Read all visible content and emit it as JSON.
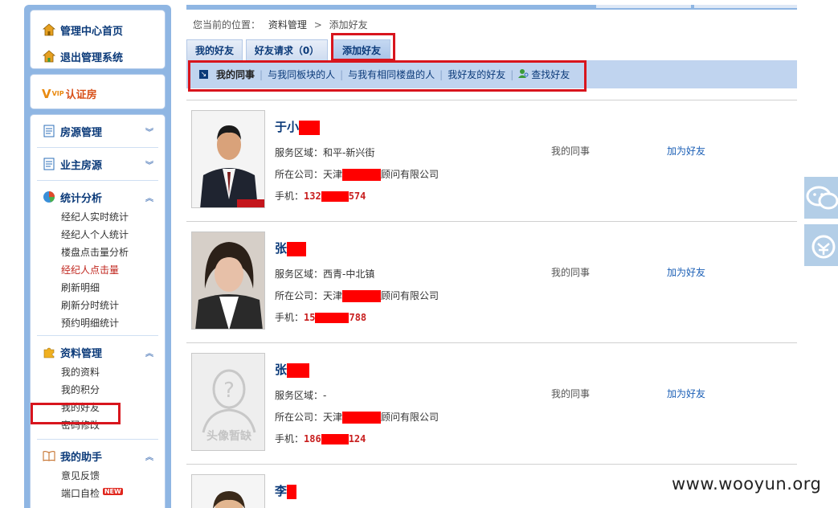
{
  "sidebar": {
    "top": {
      "home_label": "管理中心首页",
      "logout_label": "退出管理系统"
    },
    "vip": {
      "v": "V",
      "vip_tag": "VIP",
      "label": "认证房"
    },
    "groups": [
      {
        "title": "房源管理",
        "items": []
      },
      {
        "title": "业主房源",
        "items": []
      },
      {
        "title": "统计分析",
        "items": [
          "经纪人实时统计",
          "经纪人个人统计",
          "楼盘点击量分析",
          "经纪人点击量",
          "刷新明细",
          "刷新分时统计",
          "预约明细统计"
        ]
      },
      {
        "title": "资料管理",
        "items": [
          "我的资料",
          "我的积分",
          "我的好友",
          "密码修改"
        ]
      },
      {
        "title": "我的助手",
        "items": [
          "意见反馈",
          "端口自检"
        ]
      }
    ],
    "new_badge": "NEW"
  },
  "breadcrumb": {
    "prefix": "您当前的位置：",
    "level1": "资料管理",
    "sep": ">",
    "level2": "添加好友"
  },
  "tabs": [
    {
      "label": "我的好友"
    },
    {
      "label": "好友请求（0）"
    },
    {
      "label": "添加好友"
    }
  ],
  "subnav": {
    "current": "我的同事",
    "links": [
      "与我同板块的人",
      "与我有相同楼盘的人",
      "我好友的好友",
      "查找好友"
    ],
    "sep": "|"
  },
  "cards": [
    {
      "name": "于小",
      "area_label": "服务区域：",
      "area": "和平-新兴街",
      "company_label": "所在公司：",
      "company_pre": "天津",
      "company_post": "顾问有限公司",
      "phone_label": "手机：",
      "phone_pre": "132",
      "phone_post": "574",
      "relation": "我的同事",
      "action": "加为好友"
    },
    {
      "name": "张",
      "area_label": "服务区域：",
      "area": "西青-中北镇",
      "company_label": "所在公司：",
      "company_pre": "天津",
      "company_post": "顾问有限公司",
      "phone_label": "手机：",
      "phone_pre": "15",
      "phone_post": "788",
      "relation": "我的同事",
      "action": "加为好友"
    },
    {
      "name": "张",
      "area_label": "服务区域：",
      "area": "-",
      "company_label": "所在公司：",
      "company_pre": "天津",
      "company_post": "顾问有限公司",
      "phone_label": "手机：",
      "phone_pre": "186",
      "phone_post": "124",
      "relation": "我的同事",
      "action": "加为好友",
      "placeholder_text": "头像暂缺"
    },
    {
      "name": "李"
    }
  ],
  "watermark": "www.wooyun.org"
}
